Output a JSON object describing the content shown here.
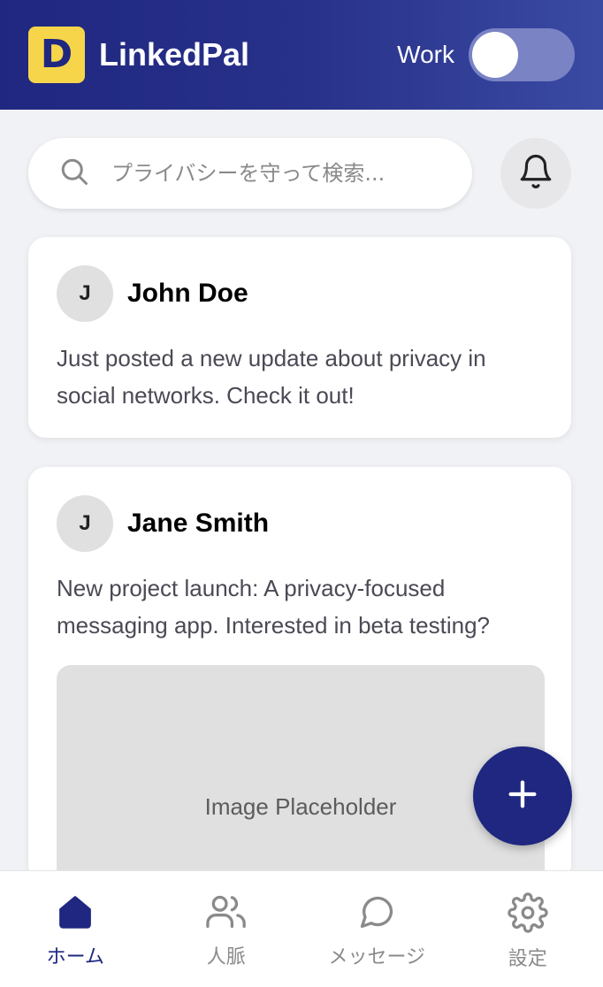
{
  "header": {
    "app_title": "LinkedPal",
    "logo_letter": "D",
    "mode_label": "Work",
    "mode_toggle_on": false
  },
  "search": {
    "placeholder": "プライバシーを守って検索...",
    "icon": "search-icon"
  },
  "notifications": {
    "icon": "bell-icon"
  },
  "posts": [
    {
      "avatar_initial": "J",
      "author": "John Doe",
      "text": "Just posted a new update about privacy in social networks. Check it out!"
    },
    {
      "avatar_initial": "J",
      "author": "Jane Smith",
      "text": "New project launch: A privacy-focused messaging app. Interested in beta testing?",
      "image_label": "Image Placeholder"
    }
  ],
  "fab": {
    "icon": "plus-icon"
  },
  "bottom_nav": [
    {
      "label": "ホーム",
      "icon": "home-icon",
      "active": true
    },
    {
      "label": "人脈",
      "icon": "people-icon",
      "active": false
    },
    {
      "label": "メッセージ",
      "icon": "chat-bubble-icon",
      "active": false
    },
    {
      "label": "設定",
      "icon": "gear-icon",
      "active": false
    }
  ],
  "colors": {
    "primary": "#1f2780",
    "logo_bg": "#f7d54a",
    "background": "#f1f2f5",
    "inactive_nav": "#8a8a8a"
  }
}
